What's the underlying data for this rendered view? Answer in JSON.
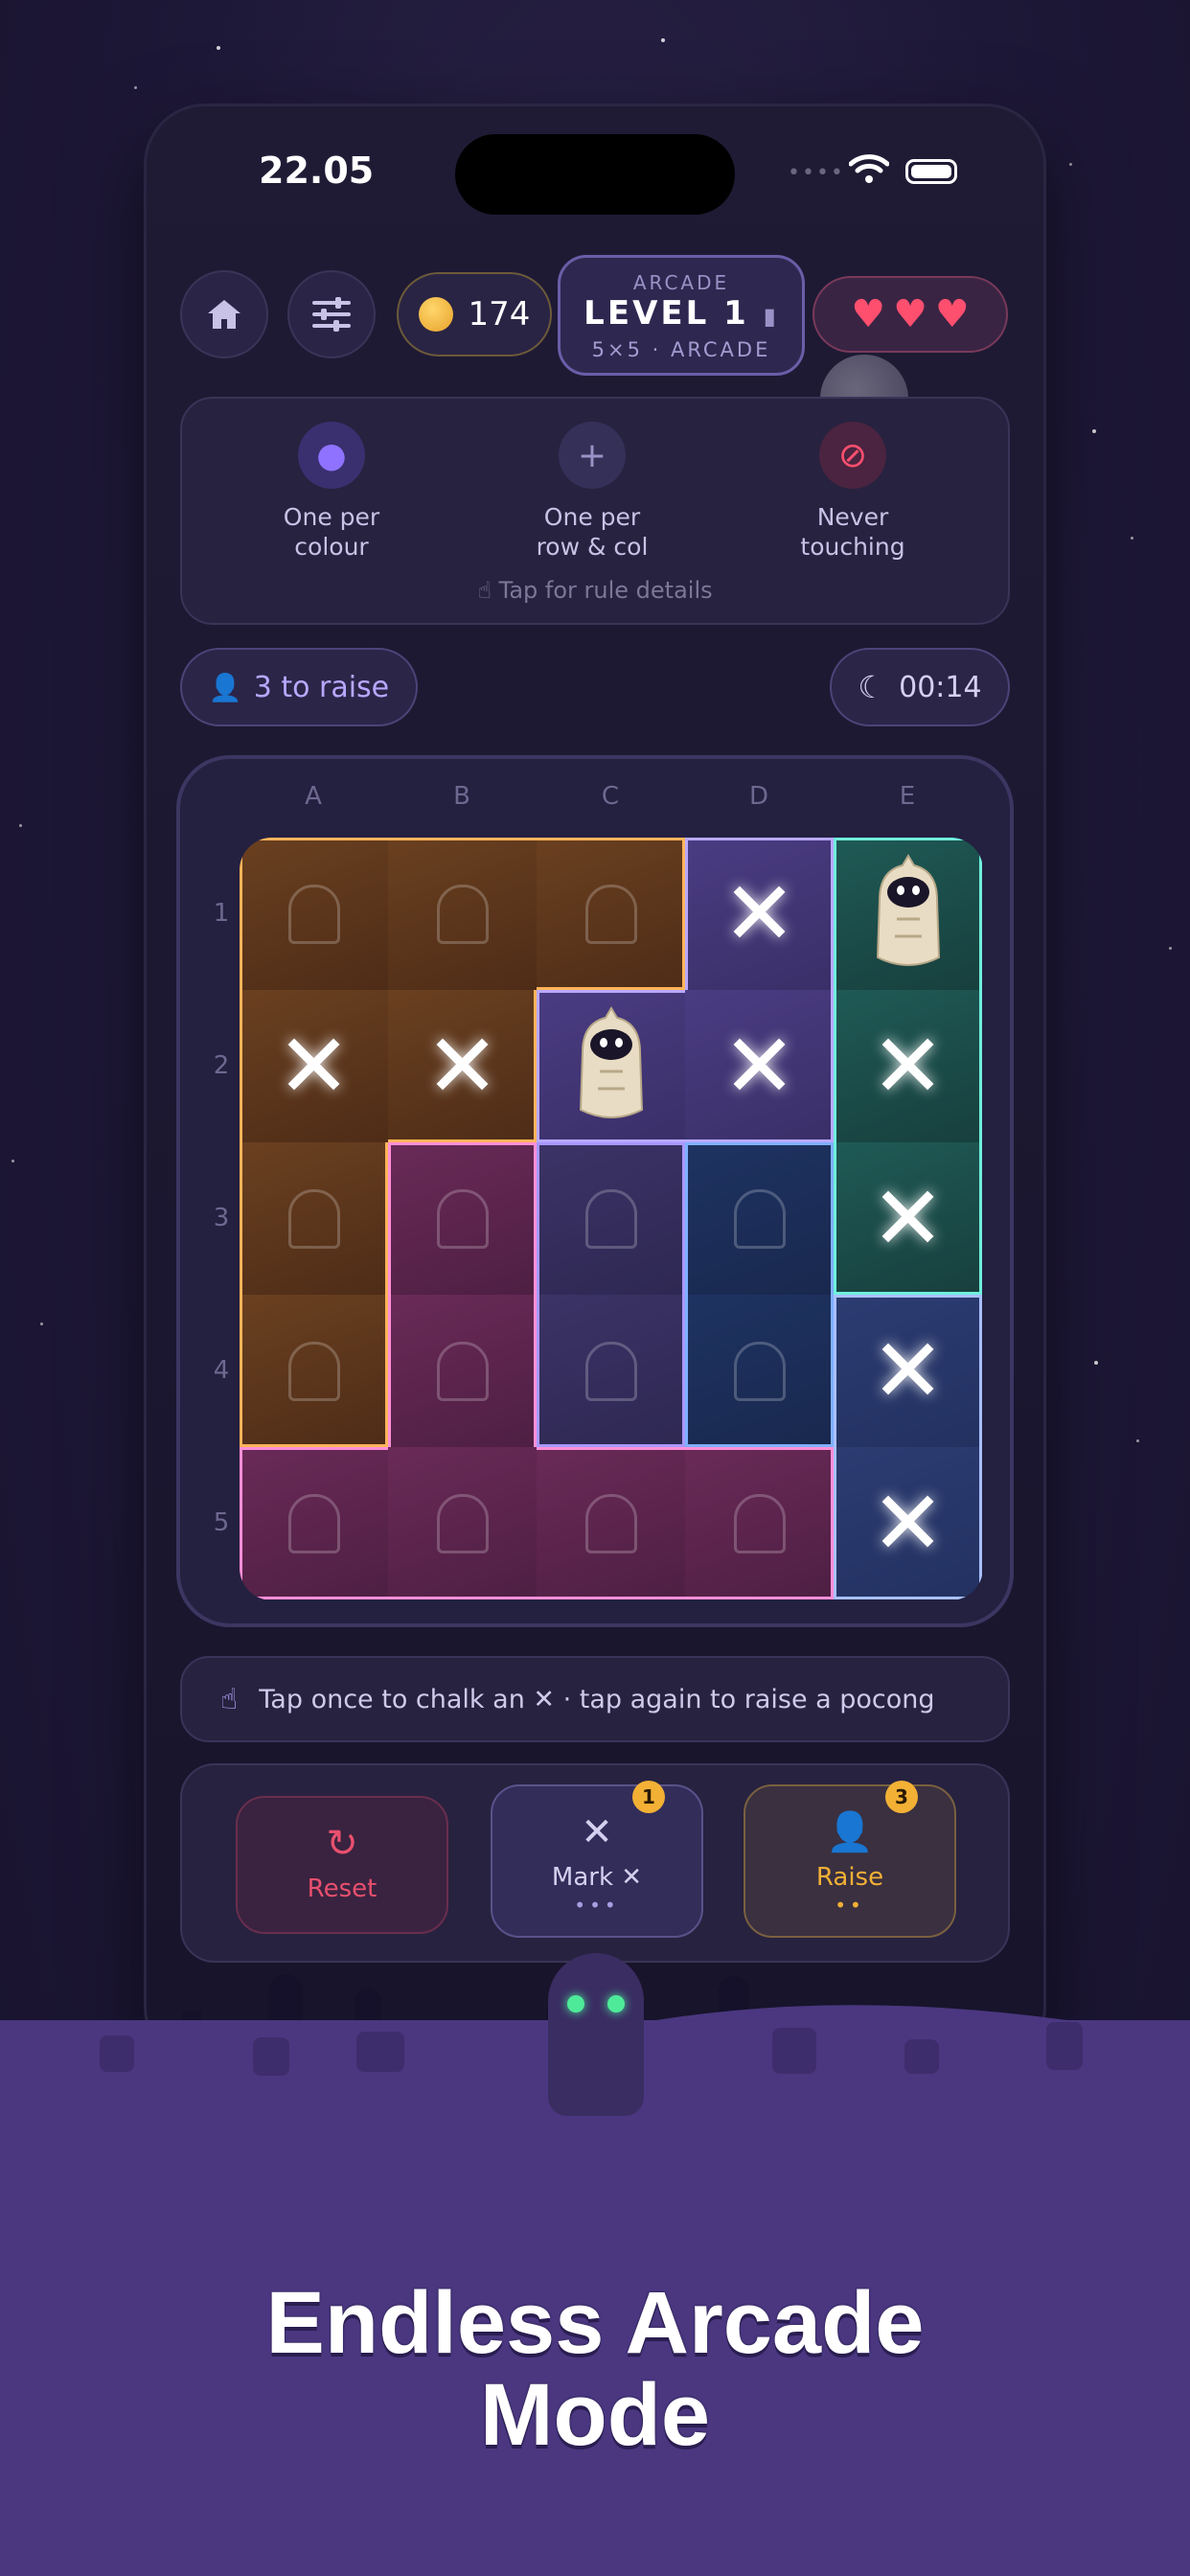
{
  "status_bar": {
    "time": "22.05",
    "signal_dots": "••••"
  },
  "header": {
    "home_icon": "home-icon",
    "settings_icon": "sliders-icon",
    "coins": "174",
    "level": {
      "kicker": "ARCADE",
      "title": "LEVEL 1",
      "subtitle": "5×5 · ARCADE"
    },
    "lives": 3
  },
  "rules": {
    "items": [
      {
        "icon": "palette-icon",
        "label_line1": "One per",
        "label_line2": "colour",
        "color": "#7b5cf0"
      },
      {
        "icon": "plus-icon",
        "label_line1": "One per",
        "label_line2": "row & col",
        "color": "#8a80c8"
      },
      {
        "icon": "no-touch-icon",
        "label_line1": "Never",
        "label_line2": "touching",
        "color": "#ff4f6f"
      }
    ],
    "hint": "Tap for rule details"
  },
  "raise_counter": "3 to raise",
  "timer": "00:14",
  "board": {
    "columns": [
      "A",
      "B",
      "C",
      "D",
      "E"
    ],
    "rows": [
      "1",
      "2",
      "3",
      "4",
      "5"
    ],
    "cells": [
      [
        {
          "region": "orange",
          "state": "empty"
        },
        {
          "region": "orange",
          "state": "empty"
        },
        {
          "region": "orange",
          "state": "empty"
        },
        {
          "region": "purple",
          "state": "x"
        },
        {
          "region": "teal",
          "state": "pocong"
        }
      ],
      [
        {
          "region": "orange",
          "state": "x"
        },
        {
          "region": "orange",
          "state": "x"
        },
        {
          "region": "purple",
          "state": "pocong"
        },
        {
          "region": "purple",
          "state": "x"
        },
        {
          "region": "teal",
          "state": "x"
        }
      ],
      [
        {
          "region": "orange",
          "state": "empty"
        },
        {
          "region": "magenta",
          "state": "empty"
        },
        {
          "region": "violet",
          "state": "empty"
        },
        {
          "region": "blue",
          "state": "empty"
        },
        {
          "region": "teal",
          "state": "x"
        }
      ],
      [
        {
          "region": "orange",
          "state": "empty"
        },
        {
          "region": "magenta",
          "state": "empty"
        },
        {
          "region": "violet",
          "state": "empty"
        },
        {
          "region": "blue",
          "state": "empty"
        },
        {
          "region": "slate",
          "state": "x"
        }
      ],
      [
        {
          "region": "magenta",
          "state": "empty"
        },
        {
          "region": "magenta",
          "state": "empty"
        },
        {
          "region": "magenta",
          "state": "empty"
        },
        {
          "region": "magenta",
          "state": "empty"
        },
        {
          "region": "slate",
          "state": "x"
        }
      ]
    ]
  },
  "instruction": "Tap once to chalk an ✕ · tap again to raise a pocong",
  "actions": {
    "reset": {
      "label": "Reset",
      "color": "#e8506e"
    },
    "mark": {
      "label": "Mark ✕",
      "badge": "1",
      "dots": "•••"
    },
    "raise": {
      "label": "Raise",
      "badge": "3",
      "dots": "••",
      "color": "#f2b035"
    }
  },
  "headline_line1": "Endless Arcade",
  "headline_line2": "Mode"
}
